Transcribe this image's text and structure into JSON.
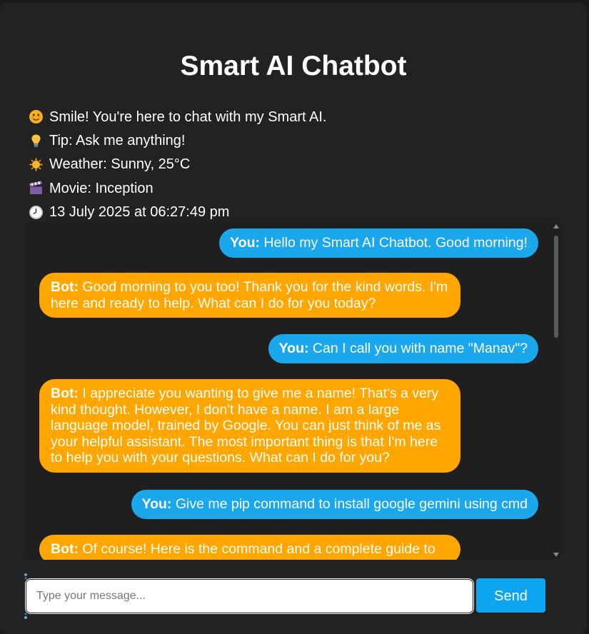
{
  "app": {
    "title": "Smart AI Chatbot"
  },
  "info": [
    {
      "icon": "smiling-face-icon",
      "text": "Smile! You're here to chat with my Smart AI."
    },
    {
      "icon": "light-bulb-icon",
      "text": "Tip: Ask me anything!"
    },
    {
      "icon": "sun-icon",
      "text": "Weather: Sunny, 25°C"
    },
    {
      "icon": "clapperboard-icon",
      "text": "Movie: Inception"
    },
    {
      "icon": "clock-icon",
      "text": "13 July 2025 at 06:27:49 pm"
    }
  ],
  "messages": [
    {
      "role": "user",
      "sender": "You:",
      "text": "Hello my Smart AI Chatbot. Good morning!"
    },
    {
      "role": "bot",
      "sender": "Bot:",
      "text": "Good morning to you too! Thank you for the kind words. I'm here and ready to help. What can I do for you today?"
    },
    {
      "role": "user",
      "sender": "You:",
      "text": "Can I call you with name \"Manav\"?"
    },
    {
      "role": "bot",
      "sender": "Bot:",
      "text": "I appreciate you wanting to give me a name! That's a very kind thought. However, I don't have a name. I am a large language model, trained by Google. You can just think of me as your helpful assistant. The most important thing is that I'm here to help you with your questions. What can I do for you?"
    },
    {
      "role": "user",
      "sender": "You:",
      "text": "Give me pip command to install google gemini using cmd"
    },
    {
      "role": "bot",
      "sender": "Bot:",
      "text": "Of course! Here is the command and a complete guide to"
    }
  ],
  "composer": {
    "placeholder": "Type your message...",
    "value": "",
    "send_label": "Send"
  },
  "colors": {
    "background": "#222223",
    "chat_background": "#1f1f20",
    "user_bubble": "#1aa7ec",
    "bot_bubble": "#ffa600",
    "send_button": "#0ea5f0"
  }
}
